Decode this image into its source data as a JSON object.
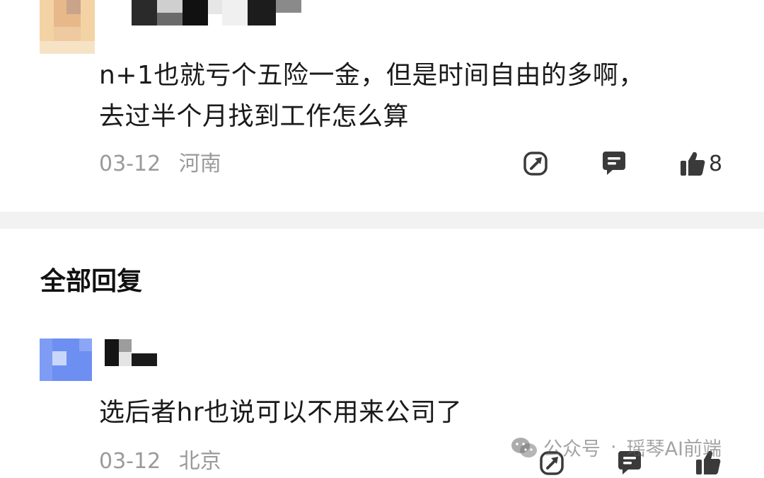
{
  "comment": {
    "text_line1": "n+1也就亏个五险一金，但是时间自由的多啊，",
    "text_line2": "去过半个月找到工作怎么算",
    "date": "03-12",
    "location": "河南",
    "like_count": "8"
  },
  "replies_section": {
    "title": "全部回复"
  },
  "reply": {
    "text": "选后者hr也说可以不用来公司了",
    "date": "03-12",
    "location": "北京"
  },
  "watermark": {
    "label": "公众号",
    "separator": "·",
    "account": "瑶琴AI前端"
  },
  "icons": {
    "share": "share-icon",
    "comment": "comment-icon",
    "like": "thumbs-up-icon",
    "watermark": "wechat-icon"
  },
  "colors": {
    "meta_text": "#9a9a9a",
    "divider": "#f2f2f2",
    "icon": "#3a3a3a"
  }
}
